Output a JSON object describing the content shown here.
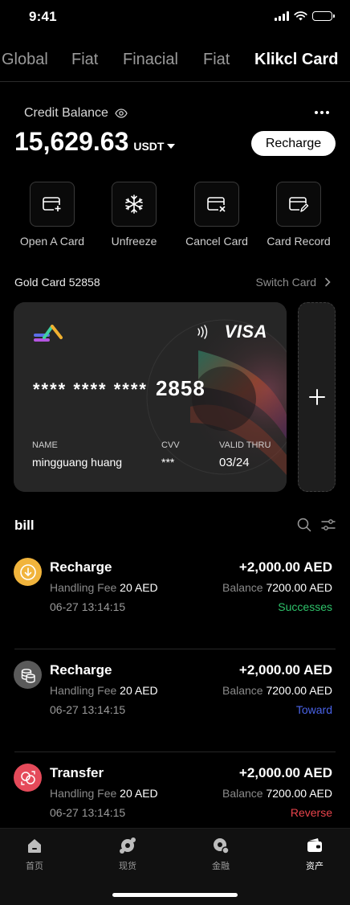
{
  "status_bar": {
    "time": "9:41"
  },
  "tabs": [
    {
      "label": "Global",
      "active": false
    },
    {
      "label": "Fiat",
      "active": false
    },
    {
      "label": "Finacial",
      "active": false
    },
    {
      "label": "Fiat",
      "active": false
    },
    {
      "label": "Klikcl Card",
      "active": true
    }
  ],
  "balance": {
    "label": "Credit Balance",
    "amount": "15,629.63",
    "unit": "USDT",
    "recharge_label": "Recharge"
  },
  "actions": [
    {
      "label": "Open A Card",
      "icon": "card-add-icon"
    },
    {
      "label": "Unfreeze",
      "icon": "snowflake-icon"
    },
    {
      "label": "Cancel Card",
      "icon": "card-cancel-icon"
    },
    {
      "label": "Card Record",
      "icon": "card-edit-icon"
    }
  ],
  "card_section": {
    "title": "Gold Card 52858",
    "switch_label": "Switch Card"
  },
  "card": {
    "brand": "VISA",
    "masked": "**** **** ****",
    "last4": "2858",
    "name_label": "NAME",
    "name": "mingguang huang",
    "cvv_label": "CVV",
    "cvv": "***",
    "valid_label": "VALID THRU",
    "valid": "03/24"
  },
  "bill": {
    "title": "bill",
    "items": [
      {
        "name": "Recharge",
        "fee_label": "Handling Fee",
        "fee": "20 AED",
        "time": "06-27 13:14:15",
        "amount": "+2,000.00 AED",
        "balance_label": "Balance",
        "balance": "7200.00 AED",
        "status": "Successes",
        "status_color": "#2ec26a",
        "icon": "download-icon",
        "icon_color": "#f1b43c"
      },
      {
        "name": "Recharge",
        "fee_label": "Handling Fee",
        "fee": "20 AED",
        "time": "06-27 13:14:15",
        "amount": "+2,000.00 AED",
        "balance_label": "Balance",
        "balance": "7200.00 AED",
        "status": "Toward",
        "status_color": "#4a63e8",
        "icon": "coins-icon",
        "icon_color": "#5a5a5a"
      },
      {
        "name": "Transfer",
        "fee_label": "Handling Fee",
        "fee": "20 AED",
        "time": "06-27 13:14:15",
        "amount": "+2,000.00 AED",
        "balance_label": "Balance",
        "balance": "7200.00 AED",
        "status": "Reverse",
        "status_color": "#e8434b",
        "icon": "transfer-icon",
        "icon_color": "#e54a5a"
      }
    ]
  },
  "bottom_nav": [
    {
      "label": "首页",
      "icon": "home-icon",
      "active": false
    },
    {
      "label": "现货",
      "icon": "spot-icon",
      "active": false
    },
    {
      "label": "金融",
      "icon": "finance-icon",
      "active": false
    },
    {
      "label": "资产",
      "icon": "wallet-icon",
      "active": true
    }
  ]
}
